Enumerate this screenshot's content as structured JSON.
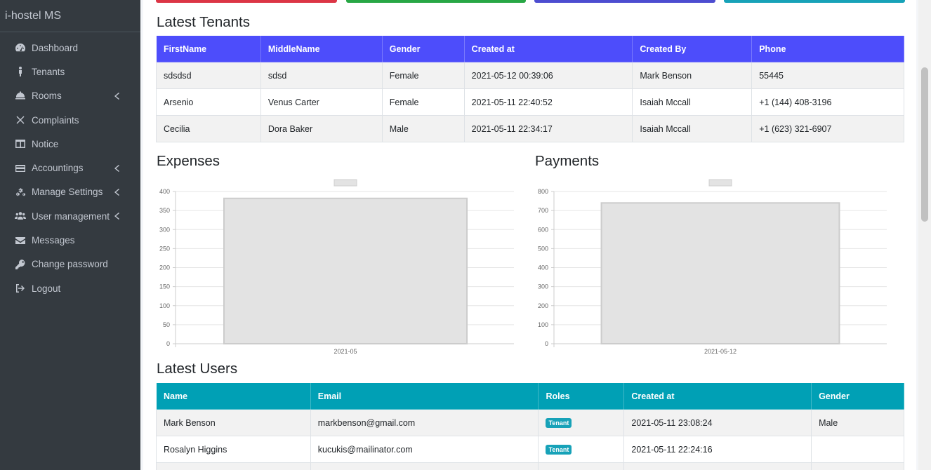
{
  "app": {
    "brand": "i-hostel MS"
  },
  "sidebar": {
    "items": [
      {
        "label": "Dashboard",
        "icon": "dashboard-icon",
        "has_submenu": false
      },
      {
        "label": "Tenants",
        "icon": "person-icon",
        "has_submenu": false
      },
      {
        "label": "Rooms",
        "icon": "bell-icon",
        "has_submenu": true
      },
      {
        "label": "Complaints",
        "icon": "times-icon",
        "has_submenu": false
      },
      {
        "label": "Notice",
        "icon": "columns-icon",
        "has_submenu": false
      },
      {
        "label": "Accountings",
        "icon": "credit-card-icon",
        "has_submenu": true
      },
      {
        "label": "Manage Settings",
        "icon": "cogs-icon",
        "has_submenu": true
      },
      {
        "label": "User management",
        "icon": "users-icon",
        "has_submenu": true
      },
      {
        "label": "Messages",
        "icon": "envelope-icon",
        "has_submenu": false
      },
      {
        "label": "Change password",
        "icon": "key-icon",
        "has_submenu": false
      },
      {
        "label": "Logout",
        "icon": "sign-out-icon",
        "has_submenu": false
      }
    ]
  },
  "colors": {
    "info_boxes": [
      "#dc3545",
      "#28a745",
      "#4d4dd0",
      "#17a2b8"
    ],
    "tenants_header": "#4d4dfb",
    "users_header": "#00a0b5"
  },
  "tenants": {
    "title": "Latest Tenants",
    "headers": [
      "FirstName",
      "MiddleName",
      "Gender",
      "Created at",
      "Created By",
      "Phone"
    ],
    "rows": [
      [
        "sdsdsd",
        "sdsd",
        "Female",
        "2021-05-12 00:39:06",
        "Mark Benson",
        "55445"
      ],
      [
        "Arsenio",
        "Venus Carter",
        "Female",
        "2021-05-11 22:40:52",
        "Isaiah Mccall",
        "+1 (144) 408-3196"
      ],
      [
        "Cecilia",
        "Dora Baker",
        "Male",
        "2021-05-11 22:34:17",
        "Isaiah Mccall",
        "+1 (623) 321-6907"
      ]
    ]
  },
  "expenses": {
    "title": "Expenses"
  },
  "payments": {
    "title": "Payments"
  },
  "chart_data": [
    {
      "type": "bar",
      "title": "Expenses",
      "categories": [
        "2021-05"
      ],
      "series": [
        {
          "values": [
            382
          ]
        }
      ],
      "ylim": [
        0,
        400
      ],
      "yticks": [
        0,
        50,
        100,
        150,
        200,
        250,
        300,
        350,
        400
      ],
      "grid": true,
      "legend": "top"
    },
    {
      "type": "bar",
      "title": "Payments",
      "categories": [
        "2021-05-12"
      ],
      "series": [
        {
          "values": [
            740
          ]
        }
      ],
      "ylim": [
        0,
        800
      ],
      "yticks": [
        0,
        100,
        200,
        300,
        400,
        500,
        600,
        700,
        800
      ],
      "grid": true,
      "legend": "top"
    }
  ],
  "users": {
    "title": "Latest Users",
    "headers": [
      "Name",
      "Email",
      "Roles",
      "Created at",
      "Gender"
    ],
    "rows": [
      [
        "Mark Benson",
        "markbenson@gmail.com",
        "Tenant",
        "2021-05-11 23:08:24",
        "Male"
      ],
      [
        "Rosalyn Higgins",
        "kucukis@mailinator.com",
        "Tenant",
        "2021-05-11 22:24:16",
        ""
      ],
      [
        "",
        "",
        "",
        "",
        ""
      ]
    ]
  }
}
